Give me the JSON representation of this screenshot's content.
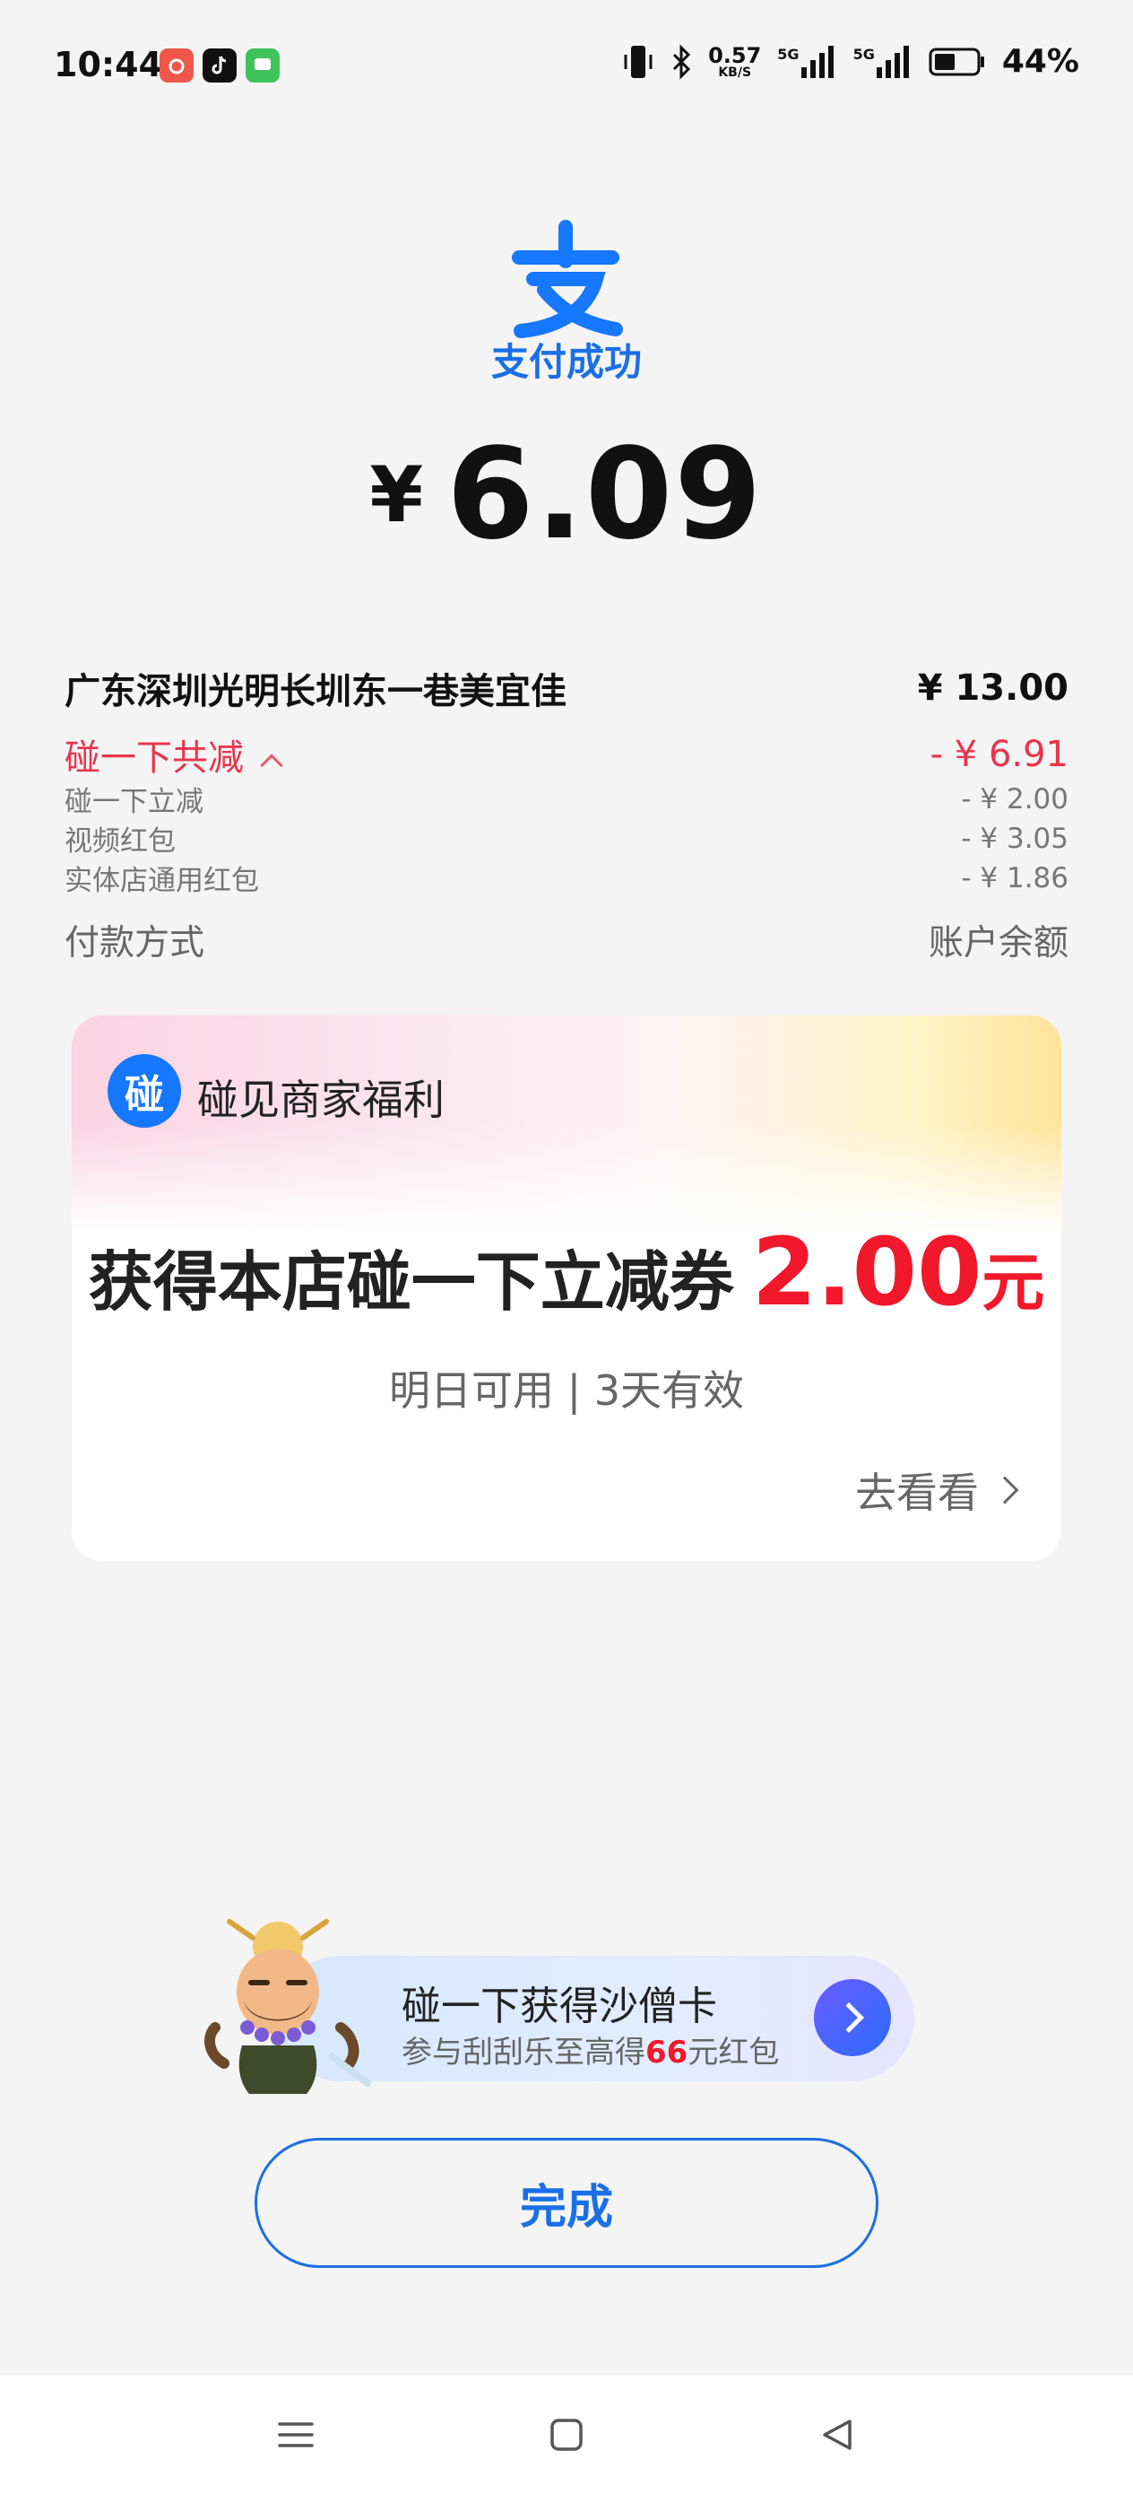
{
  "status_bar": {
    "time": "10:44",
    "net_speed_value": "0.57",
    "net_speed_unit": "KB/S",
    "signal_1": "5G",
    "signal_2": "5G",
    "battery": "44%"
  },
  "header": {
    "logo_glyph": "支",
    "status": "支付成功",
    "currency": "¥",
    "amount": "6.09"
  },
  "details": {
    "merchant": "广东深圳光明长圳东一巷美宜佳",
    "original_amount": "¥ 13.00",
    "total_reduce_label": "碰一下共减",
    "total_reduce_value": "- ¥ 6.91",
    "items": [
      {
        "label": "碰一下立减",
        "value": "- ¥ 2.00"
      },
      {
        "label": "视频红包",
        "value": "- ¥ 3.05"
      },
      {
        "label": "实体店通用红包",
        "value": "- ¥ 1.86"
      }
    ],
    "pay_method_label": "付款方式",
    "pay_method_value": "账户余额"
  },
  "coupon_card": {
    "logo_glyph": "碰",
    "title": "碰见商家福利",
    "coupon_text": "获得本店碰一下立减券",
    "coupon_value": "2.00",
    "coupon_unit": "元",
    "validity": "明日可用 | 3天有效",
    "action": "去看看"
  },
  "promo_banner": {
    "title": "碰一下获得沙僧卡",
    "sub_prefix": "参与刮刮乐至高得",
    "sub_highlight": "66",
    "sub_suffix": "元红包"
  },
  "done_button": "完成",
  "colors": {
    "brand_blue": "#1a6fe6",
    "discount_red": "#e8344b",
    "coupon_red": "#f0182a"
  }
}
